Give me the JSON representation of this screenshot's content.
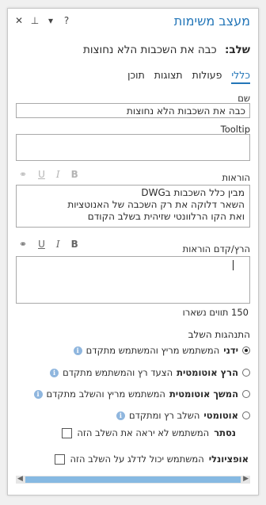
{
  "pane": {
    "title": "מעצב משימות",
    "icons": {
      "close": "✕",
      "pin": "⊥",
      "menu": "▾",
      "help": "?"
    }
  },
  "step": {
    "label": "שלב:",
    "value": "כבה את השכבות הלא נחוצות"
  },
  "tabs": [
    {
      "label": "כללי",
      "active": true
    },
    {
      "label": "פעולות",
      "active": false
    },
    {
      "label": "תצוגות",
      "active": false
    },
    {
      "label": "תוכן",
      "active": false
    }
  ],
  "name_field": {
    "label": "שם",
    "value": "כבה את השכבות הלא נחוצות"
  },
  "tooltip_field": {
    "label": "Tooltip",
    "value": ""
  },
  "format_toolbar": {
    "link": "⚭",
    "underline": "U",
    "italic": "I",
    "bold": "B"
  },
  "instructions": {
    "label": "הוראות",
    "lines": [
      "מבין כלל השכבות בDWG",
      "השאר דלוקה את רק השכבה של האנוטציות",
      "ואת הקו הרלוונטי שזיהית בשלב הקודם"
    ]
  },
  "pre_instructions": {
    "label": "הרץ/קדם הוראות",
    "value": ""
  },
  "char_counter": "150 תווים נשארו",
  "behavior": {
    "title": "התנהגות השלב",
    "options": [
      {
        "bold": "ידני",
        "text": "המשתמש מריץ והמשתמש מתקדם",
        "checked": true
      },
      {
        "bold": "הרץ אוטומטית",
        "text": "הצעד רץ והמשתמש מתקדם",
        "checked": false
      },
      {
        "bold": "המשך אוטומטית",
        "text": "המשתמש מריץ והשלב מתקדם",
        "checked": false
      },
      {
        "bold": "אוטומטי",
        "text": "השלב רץ ומתקדם",
        "checked": false
      }
    ]
  },
  "hidden": {
    "bold": "נסתר",
    "text": "המשתמש לא יראה את השלב הזה",
    "checked": false
  },
  "optional": {
    "bold": "אופציונלי",
    "text": "המשתמש יכול לדלג על השלב הזה",
    "checked": false
  },
  "colors": {
    "accent": "#2376b8",
    "info": "#8fb6de",
    "scroll_thumb": "#86b9e2"
  }
}
